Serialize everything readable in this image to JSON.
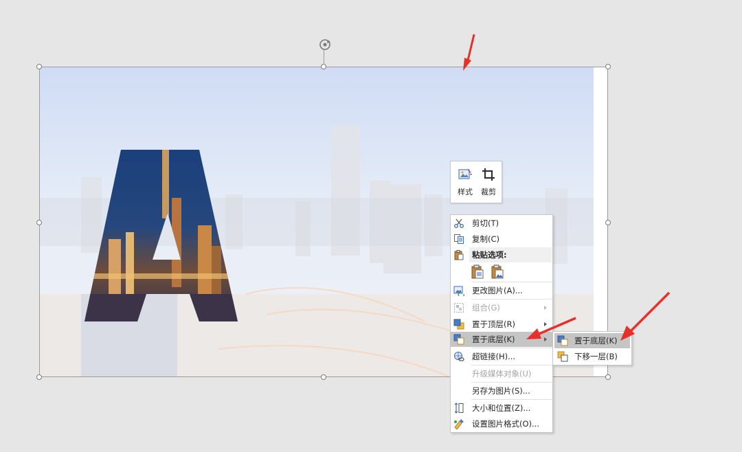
{
  "mini_toolbar": {
    "style_label": "样式",
    "crop_label": "裁剪"
  },
  "context_menu": {
    "items": [
      {
        "label": "剪切(T)",
        "enabled": true,
        "icon": "scissors-icon"
      },
      {
        "label": "复制(C)",
        "enabled": true,
        "icon": "copy-icon"
      },
      {
        "label": "粘贴选项:",
        "header": true,
        "icon": "paste-icon"
      },
      {
        "label": "更改图片(A)...",
        "enabled": true,
        "icon": "change-picture-icon"
      },
      {
        "label": "组合(G)",
        "enabled": false,
        "submenu": true,
        "icon": "group-icon"
      },
      {
        "label": "置于顶层(R)",
        "enabled": true,
        "submenu": true,
        "icon": "bring-to-front-icon"
      },
      {
        "label": "置于底层(K)",
        "enabled": true,
        "submenu": true,
        "highlighted": true,
        "icon": "send-to-back-icon"
      },
      {
        "label": "超链接(H)...",
        "enabled": true,
        "icon": "hyperlink-icon"
      },
      {
        "label": "升级媒体对象(U)",
        "enabled": false,
        "icon": ""
      },
      {
        "label": "另存为图片(S)...",
        "enabled": true,
        "icon": ""
      },
      {
        "label": "大小和位置(Z)...",
        "enabled": true,
        "icon": "size-position-icon"
      },
      {
        "label": "设置图片格式(O)...",
        "enabled": true,
        "icon": "format-picture-icon"
      }
    ]
  },
  "submenu": {
    "items": [
      {
        "label": "置于底层(K)",
        "highlighted": true,
        "icon": "send-to-back-icon"
      },
      {
        "label": "下移一层(B)",
        "highlighted": false,
        "icon": "send-backward-icon"
      }
    ]
  },
  "slide_letter": "A",
  "colors": {
    "highlight": "#c5c5c5",
    "annotation_arrow": "#e8302a",
    "letter_blue": "#1f5fae"
  }
}
